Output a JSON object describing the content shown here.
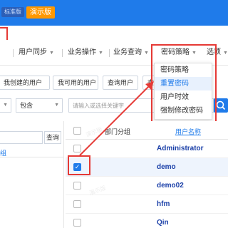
{
  "header": {
    "edition_badge": "标准版",
    "demo_badge": "演示版"
  },
  "menu": {
    "items": [
      {
        "label": "用户同步"
      },
      {
        "label": "业务操作"
      },
      {
        "label": "业务查询"
      },
      {
        "label": "密码策略"
      },
      {
        "label": "选项"
      }
    ]
  },
  "dropdown": {
    "items": [
      {
        "label": "密码策略"
      },
      {
        "label": "重置密码"
      },
      {
        "label": "用户时效"
      },
      {
        "label": "强制修改密码"
      }
    ]
  },
  "toolbar": {
    "buttons": [
      {
        "label": "我创建的用户"
      },
      {
        "label": "我可用的用户"
      },
      {
        "label": "查询用户"
      },
      {
        "label": "查"
      }
    ]
  },
  "filter": {
    "condition": "包含",
    "keyword_placeholder": "请输入或选择关键字"
  },
  "left": {
    "query_label": "查询",
    "tab_label": "组"
  },
  "table": {
    "headers": {
      "dept": "部门分组",
      "username": "用户名称"
    },
    "rows": [
      {
        "username": "Administrator",
        "checked": false
      },
      {
        "username": "demo",
        "checked": true
      },
      {
        "username": "demo02",
        "checked": false
      },
      {
        "username": "hfm",
        "checked": false
      },
      {
        "username": "Qin",
        "checked": false
      }
    ]
  },
  "watermark": "演示版",
  "colors": {
    "primary": "#1f7bea",
    "highlight": "#e53935",
    "demo": "#ff9800"
  }
}
